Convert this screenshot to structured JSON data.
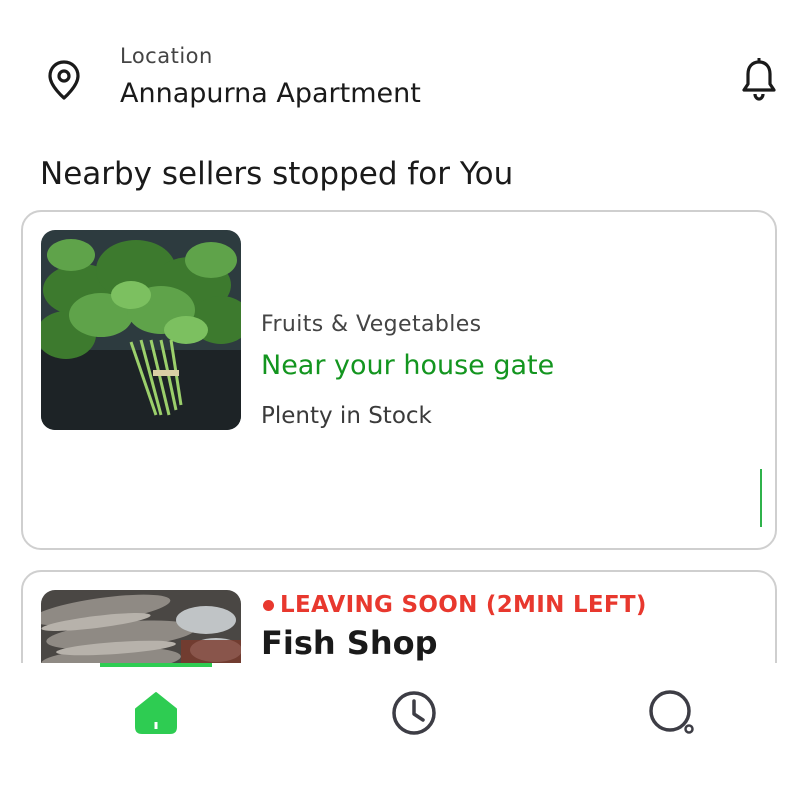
{
  "header": {
    "location_label": "Location",
    "location_value": "Annapurna Apartment",
    "location_icon": "map-pin-icon",
    "notification_icon": "bell-icon"
  },
  "section": {
    "title": "Nearby sellers stopped for You"
  },
  "sellers": [
    {
      "category": "Fruits & Vegetables",
      "location_status": "Near your house gate",
      "stock": "Plenty in Stock",
      "image": "spinach-photo"
    },
    {
      "status": "LEAVING SOON (2MIN LEFT)",
      "name": "Fish Shop",
      "image": "fish-photo"
    }
  ],
  "tabbar": {
    "tabs": [
      {
        "icon": "home-icon",
        "active": true
      },
      {
        "icon": "clock-icon",
        "active": false
      },
      {
        "icon": "search-icon",
        "active": false
      }
    ]
  },
  "colors": {
    "accent_green": "#2ecc52",
    "text_green": "#13951f",
    "alert_red": "#e8382e"
  }
}
